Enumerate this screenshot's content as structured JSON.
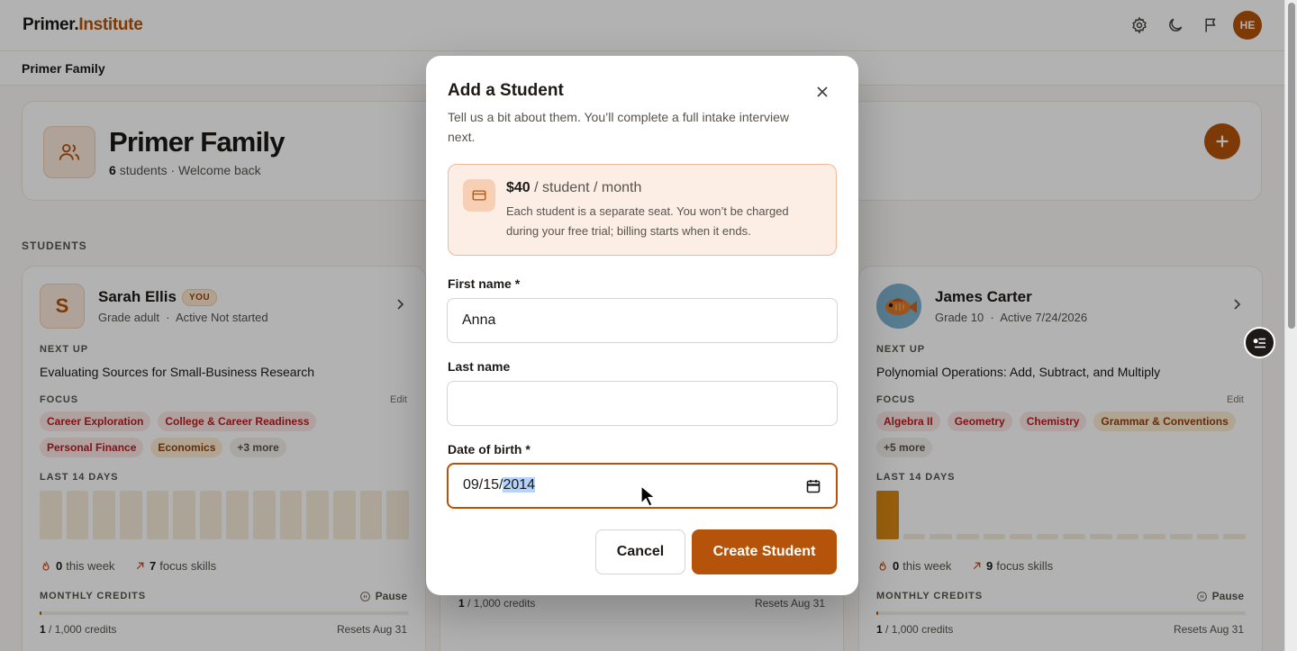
{
  "nav": {
    "logo_primary": "Primer.",
    "logo_accent": "Institute",
    "icons": [
      "gear-icon",
      "moon-icon",
      "flag-icon"
    ],
    "avatar_initials": "HE",
    "brand_color": "#b45309"
  },
  "breadcrumb": {
    "title": "Primer Family"
  },
  "family": {
    "title": "Primer Family",
    "student_count": "6",
    "subtitle_suffix": "students · Welcome back"
  },
  "students_label": "STUDENTS",
  "cards": [
    {
      "initial": "S",
      "name": "Sarah Ellis",
      "badge": "YOU",
      "meta": "Grade adult  ·  Active Not started",
      "next_up_label": "NEXT UP",
      "next_up": "Evaluating Sources for Small-Business Research",
      "focus_label": "FOCUS",
      "edit_label": "Edit",
      "tags": [
        {
          "label": "Career Exploration",
          "tone": "red"
        },
        {
          "label": "College & Career Readiness",
          "tone": "red"
        },
        {
          "label": "Personal Finance",
          "tone": "red"
        },
        {
          "label": "Economics",
          "tone": "amber"
        },
        {
          "label": "+3 more",
          "tone": "more"
        }
      ],
      "last14_label": "LAST 14 DAYS",
      "activity": [
        0,
        0,
        0,
        0,
        0,
        0,
        0,
        0,
        0,
        0,
        0,
        0,
        0,
        0
      ],
      "week_count": "0",
      "week_label": "this week",
      "skills_count": "7",
      "skills_label": "focus skills",
      "credits_label": "MONTHLY CREDITS",
      "pause_label": "Pause",
      "credits_used": "1",
      "credits_total": "/ 1,000 credits",
      "credits_fraction": 0.001,
      "resets": "Resets Aug 31"
    },
    {
      "credits_used": "1",
      "credits_total": "/ 1,000 credits",
      "resets": "Resets Aug 31"
    },
    {
      "name": "James Carter",
      "meta": "Grade 10  ·  Active 7/24/2026",
      "next_up_label": "NEXT UP",
      "next_up": "Polynomial Operations: Add, Subtract, and Multiply",
      "focus_label": "FOCUS",
      "edit_label": "Edit",
      "tags": [
        {
          "label": "Algebra II",
          "tone": "red"
        },
        {
          "label": "Geometry",
          "tone": "red"
        },
        {
          "label": "Chemistry",
          "tone": "red"
        },
        {
          "label": "Grammar & Conventions",
          "tone": "amber"
        },
        {
          "label": "+5 more",
          "tone": "more"
        }
      ],
      "last14_label": "LAST 14 DAYS",
      "activity": [
        1,
        0,
        0,
        0,
        0,
        0,
        0,
        0,
        0,
        0,
        0,
        0,
        0,
        0
      ],
      "week_count": "0",
      "week_label": "this week",
      "skills_count": "9",
      "skills_label": "focus skills",
      "credits_label": "MONTHLY CREDITS",
      "pause_label": "Pause",
      "credits_used": "1",
      "credits_total": "/ 1,000 credits",
      "credits_fraction": 0.001,
      "resets": "Resets Aug 31"
    }
  ],
  "modal": {
    "title": "Add a Student",
    "description": "Tell us a bit about them. You’ll complete a full intake interview next.",
    "price_amount": "$40",
    "price_unit": "/ student / month",
    "price_note": "Each student is a separate seat. You won’t be charged during your free trial; billing starts when it ends.",
    "first_name_label": "First name *",
    "first_name_value": "Anna",
    "last_name_label": "Last name",
    "last_name_value": "",
    "dob_label": "Date of birth *",
    "dob_month_day": "09/15/",
    "dob_year": "2014",
    "cancel_label": "Cancel",
    "create_label": "Create Student"
  }
}
